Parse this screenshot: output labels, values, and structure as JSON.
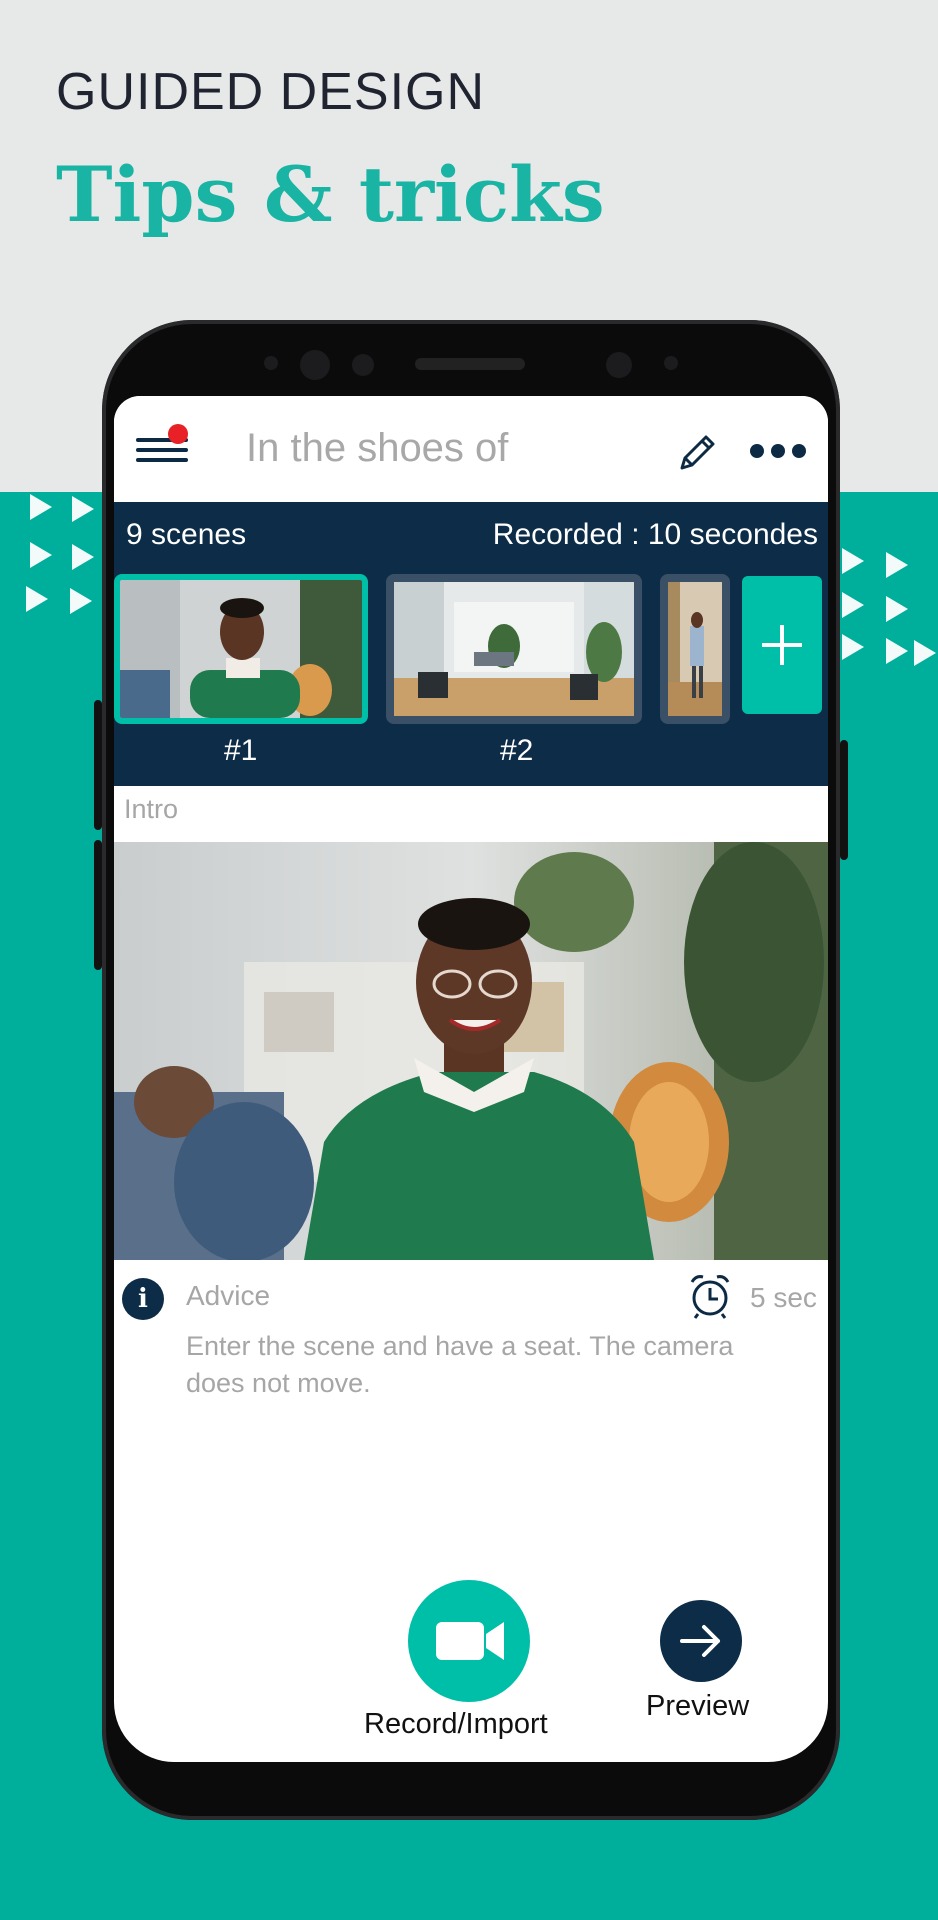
{
  "page": {
    "heading": "GUIDED DESIGN",
    "title": "Tips & tricks"
  },
  "colors": {
    "accent": "#00ae9c",
    "navy": "#0c2c47",
    "notification": "#e82127"
  },
  "app": {
    "top_bar": {
      "menu_icon": "hamburger-menu-icon",
      "doc_title": "In the shoes of",
      "edit_icon": "pencil-icon",
      "more_icon": "more-dots-icon"
    },
    "scenes_strip": {
      "count_label": "9 scenes",
      "recorded_label": "Recorded : 10 secondes",
      "thumbs": [
        {
          "label": "#1",
          "selected": true
        },
        {
          "label": "#2",
          "selected": false
        },
        {
          "label": "",
          "selected": false
        }
      ],
      "add_icon": "plus-icon"
    },
    "scene_name": "Intro",
    "advice": {
      "icon": "info-icon",
      "label": "Advice",
      "clock_icon": "alarm-clock-icon",
      "duration": "5 sec",
      "text": "Enter the scene and have a seat. The camera does not move."
    },
    "actions": {
      "record_label": "Record/Import",
      "record_icon": "video-camera-icon",
      "preview_label": "Preview",
      "preview_icon": "arrow-right-icon"
    }
  }
}
